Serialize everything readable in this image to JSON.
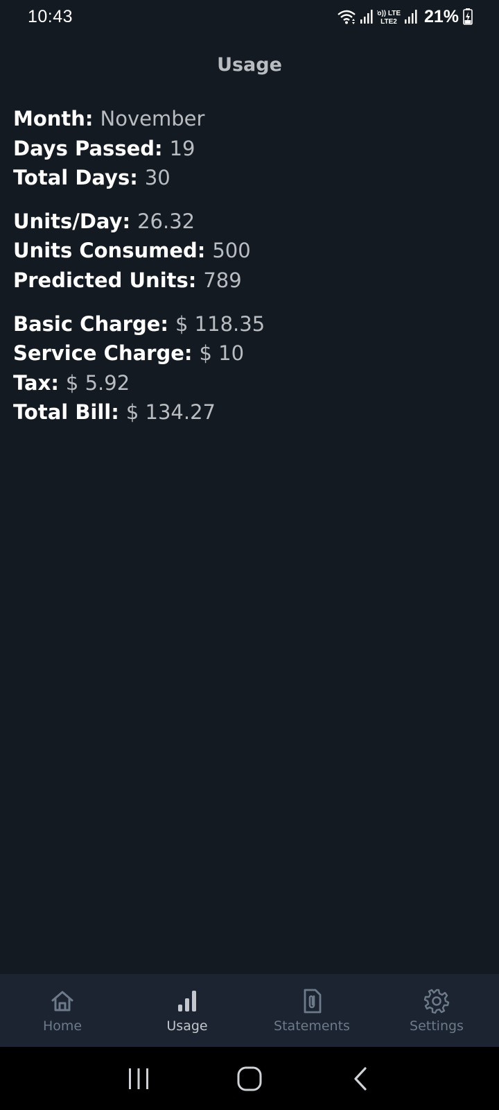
{
  "status_bar": {
    "time": "10:43",
    "battery_percent": "21%",
    "network_label": "Vo)) LTE2",
    "icons": [
      "wifi-icon",
      "signal-icon",
      "volte-lte-icon",
      "signal-icon",
      "battery-charging-icon"
    ]
  },
  "page": {
    "title": "Usage"
  },
  "info": {
    "period": [
      {
        "label": "Month:",
        "value": "November"
      },
      {
        "label": "Days Passed:",
        "value": "19"
      },
      {
        "label": "Total Days:",
        "value": "30"
      }
    ],
    "units": [
      {
        "label": "Units/Day:",
        "value": "26.32"
      },
      {
        "label": "Units Consumed:",
        "value": "500"
      },
      {
        "label": "Predicted Units:",
        "value": "789"
      }
    ],
    "charges": [
      {
        "label": "Basic Charge:",
        "value": "$ 118.35"
      },
      {
        "label": "Service Charge:",
        "value": "$ 10"
      },
      {
        "label": "Tax:",
        "value": "$ 5.92"
      },
      {
        "label": "Total Bill:",
        "value": "$ 134.27"
      }
    ]
  },
  "bottom_nav": {
    "items": [
      {
        "label": "Home",
        "icon": "home-icon",
        "active": false
      },
      {
        "label": "Usage",
        "icon": "bar-chart-icon",
        "active": true
      },
      {
        "label": "Statements",
        "icon": "paperclip-document-icon",
        "active": false
      },
      {
        "label": "Settings",
        "icon": "gear-icon",
        "active": false
      }
    ]
  },
  "system_nav": {
    "buttons": [
      "recents-icon",
      "home-button-icon",
      "back-icon"
    ]
  },
  "colors": {
    "background": "#131a22",
    "nav_background": "#1b2430",
    "label_text": "#ffffff",
    "value_text": "#b9bdc2",
    "nav_inactive": "#6c7a8a",
    "nav_active": "#c3c7cc"
  }
}
